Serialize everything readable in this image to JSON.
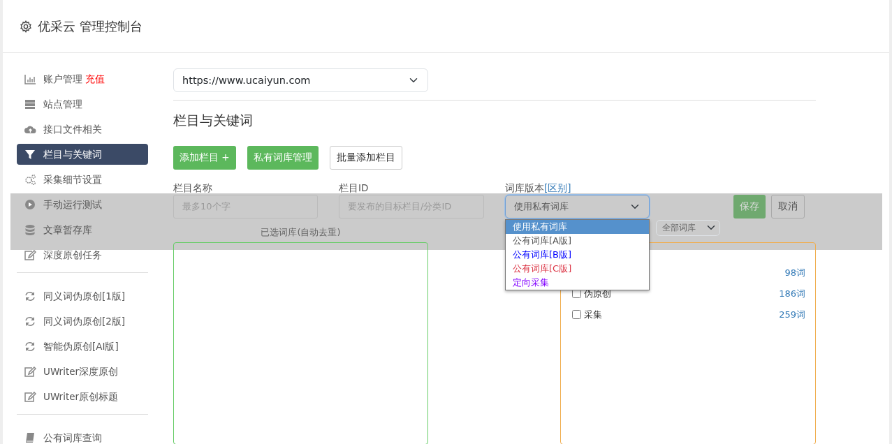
{
  "header": {
    "title": "优采云 管理控制台"
  },
  "sidebar": {
    "groups": [
      {
        "items": [
          {
            "label": "账户管理",
            "tag": "充值",
            "selected": false
          },
          {
            "label": "站点管理",
            "selected": false
          },
          {
            "label": "接口文件相关",
            "selected": false
          },
          {
            "label": "栏目与关键词",
            "selected": true
          },
          {
            "label": "采集细节设置",
            "selected": false
          },
          {
            "label": "手动运行测试",
            "selected": false
          },
          {
            "label": "文章暂存库",
            "selected": false
          },
          {
            "label": "深度原创任务",
            "selected": false
          }
        ]
      },
      {
        "items": [
          {
            "label": "同义词伪原创[1版]",
            "selected": false
          },
          {
            "label": "同义词伪原创[2版]",
            "selected": false
          },
          {
            "label": "智能伪原创[AI版]",
            "selected": false
          },
          {
            "label": "UWriter深度原创",
            "selected": false
          },
          {
            "label": "UWriter原创标题",
            "selected": false
          }
        ]
      },
      {
        "items": [
          {
            "label": "公有词库查询",
            "selected": false
          }
        ]
      }
    ]
  },
  "site_select": {
    "value": "https://www.ucaiyun.com"
  },
  "section_title": "栏目与关键词",
  "buttons": [
    {
      "label": "添加栏目 +",
      "kind": "success"
    },
    {
      "label": "私有词库管理",
      "kind": "success"
    },
    {
      "label": "批量添加栏目",
      "kind": "outline"
    }
  ],
  "form": {
    "name": {
      "label": "栏目名称",
      "placeholder": "最多10个字"
    },
    "id": {
      "label": "栏目ID",
      "placeholder": "要发布的目标栏目/分类ID"
    },
    "version": {
      "label": "词库版本",
      "link": "[区别]",
      "value": "使用私有词库",
      "expanded": true,
      "options": [
        {
          "label": "使用私有词库",
          "selected": true
        },
        {
          "label": "公有词库[A版]",
          "selected": false,
          "color": "#555555"
        },
        {
          "label": "公有词库[B版]",
          "selected": false,
          "color": "#0000ff"
        },
        {
          "label": "公有词库[C版]",
          "selected": false,
          "color": "#dc3545"
        },
        {
          "label": "定向采集",
          "selected": false,
          "color": "#8000ff"
        }
      ]
    },
    "save": "保存",
    "cancel": "取消"
  },
  "selected_panel": {
    "title": "已选词库(自动去重)"
  },
  "library_panel": {
    "filter": "全部词库",
    "rows": [
      {
        "count": "98词"
      },
      {
        "label": "伪原创",
        "checked": false,
        "count": "186词"
      },
      {
        "label": "采集",
        "checked": false,
        "count": "259词"
      }
    ]
  }
}
